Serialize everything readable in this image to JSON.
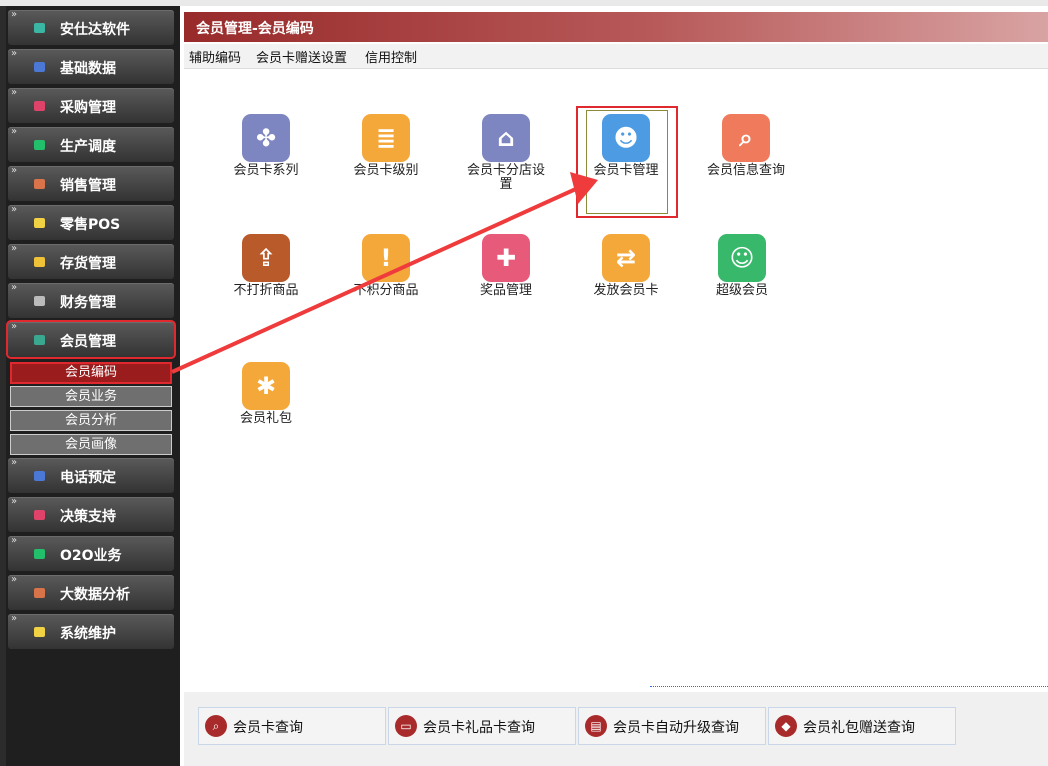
{
  "window": {
    "title": "会员管理-会员编码"
  },
  "menu": {
    "items": [
      "辅助编码",
      "会员卡赠送设置",
      "信用控制"
    ]
  },
  "sidebar": {
    "items": [
      {
        "label": "安仕达软件",
        "icon": "cube-icon",
        "color": "#3bb5a4"
      },
      {
        "label": "基础数据",
        "icon": "cube-icon",
        "color": "#4a78d4"
      },
      {
        "label": "采购管理",
        "icon": "cube-icon",
        "color": "#e0436a"
      },
      {
        "label": "生产调度",
        "icon": "cube-icon",
        "color": "#22c06a"
      },
      {
        "label": "销售管理",
        "icon": "cube-icon",
        "color": "#d9734a"
      },
      {
        "label": "零售POS",
        "icon": "cube-icon",
        "color": "#f0d244"
      },
      {
        "label": "存货管理",
        "icon": "cube-icon",
        "color": "#f0c238"
      },
      {
        "label": "财务管理",
        "icon": "cube-icon",
        "color": "#bbbbbb"
      },
      {
        "label": "会员管理",
        "icon": "cube-icon",
        "color": "#3aa78f"
      },
      {
        "label": "电话预定",
        "icon": "cube-icon",
        "color": "#4a78d4"
      },
      {
        "label": "决策支持",
        "icon": "cube-icon",
        "color": "#e0436a"
      },
      {
        "label": "O2O业务",
        "icon": "cube-icon",
        "color": "#22c06a"
      },
      {
        "label": "大数据分析",
        "icon": "cube-icon",
        "color": "#d9734a"
      },
      {
        "label": "系统维护",
        "icon": "cube-icon",
        "color": "#f0d244"
      }
    ],
    "subitems": [
      "会员编码",
      "会员业务",
      "会员分析",
      "会员画像"
    ]
  },
  "tiles": [
    {
      "label": "会员卡系列",
      "icon": "grid-icon",
      "color": "#7e86c2",
      "glyph": "✤"
    },
    {
      "label": "会员卡级别",
      "icon": "coins-icon",
      "color": "#f5a83a",
      "glyph": "≣"
    },
    {
      "label": "会员卡分店设置",
      "icon": "house-icon",
      "color": "#7e86c2",
      "glyph": "⌂"
    },
    {
      "label": "会员卡管理",
      "icon": "id-card-icon",
      "color": "#4d9be3",
      "glyph": "☻"
    },
    {
      "label": "会员信息查询",
      "icon": "search-doc-icon",
      "color": "#ef7b5c",
      "glyph": "⌕"
    },
    {
      "label": "不打折商品",
      "icon": "export-icon",
      "color": "#b85a2a",
      "glyph": "⇪"
    },
    {
      "label": "不积分商品",
      "icon": "warning-icon",
      "color": "#f5a83a",
      "glyph": "!"
    },
    {
      "label": "奖品管理",
      "icon": "gift-icon",
      "color": "#e85a7a",
      "glyph": "✚"
    },
    {
      "label": "发放会员卡",
      "icon": "exchange-icon",
      "color": "#f5a83a",
      "glyph": "⇄"
    },
    {
      "label": "超级会员",
      "icon": "user-icon",
      "color": "#38b86a",
      "glyph": "☺"
    },
    {
      "label": "会员礼包",
      "icon": "puzzle-icon",
      "color": "#f5a83a",
      "glyph": "✱"
    }
  ],
  "bottom": {
    "buttons": [
      {
        "label": "会员卡查询",
        "icon": "search-icon",
        "glyph": "⌕"
      },
      {
        "label": "会员卡礼品卡查询",
        "icon": "card-icon",
        "glyph": "▭"
      },
      {
        "label": "会员卡自动升级查询",
        "icon": "doc-icon",
        "glyph": "▤"
      },
      {
        "label": "会员礼包赠送查询",
        "icon": "tag-icon",
        "glyph": "◆"
      }
    ]
  },
  "colors": {
    "accent": "#982a2a",
    "highlight": "#e0292f"
  }
}
